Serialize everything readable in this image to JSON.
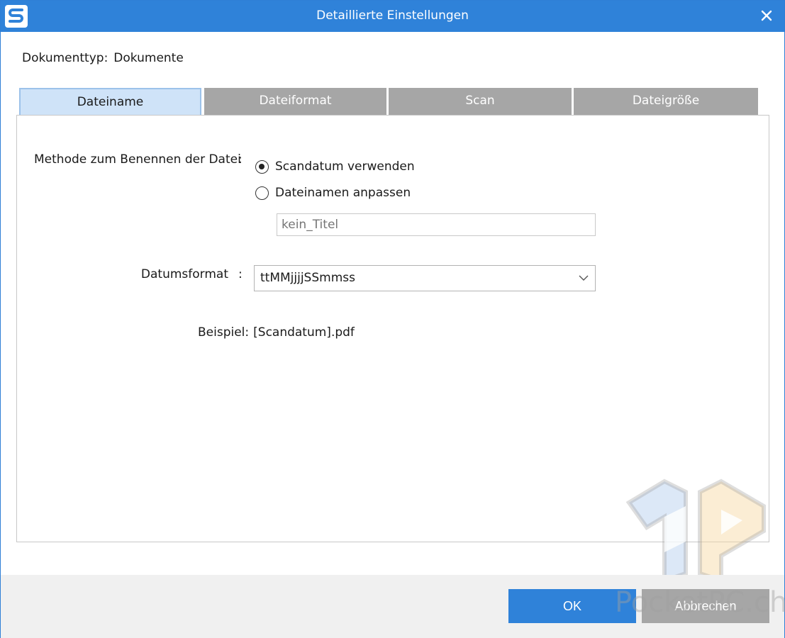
{
  "window": {
    "title": "Detaillierte Einstellungen",
    "accent": "#2f82d9"
  },
  "doctype": {
    "label": "Dokumenttyp:",
    "value": "Dokumente"
  },
  "tabs": [
    {
      "label": "Dateiname",
      "active": true
    },
    {
      "label": "Dateiformat",
      "active": false
    },
    {
      "label": "Scan",
      "active": false
    },
    {
      "label": "Dateigröße",
      "active": false
    }
  ],
  "naming": {
    "label": "Methode zum Benennen der Datei",
    "colon": ":",
    "options": [
      {
        "label": "Scandatum verwenden",
        "checked": true
      },
      {
        "label": "Dateinamen anpassen",
        "checked": false
      }
    ],
    "custom_name_placeholder": "kein_Titel"
  },
  "date_format": {
    "label": "Datumsformat",
    "colon": ":",
    "selected": "ttMMjjjjSSmmss"
  },
  "example": {
    "label": "Beispiel:",
    "value": "[Scandatum].pdf"
  },
  "buttons": {
    "ok": "OK",
    "cancel": "Abbrechen"
  },
  "watermark": {
    "text": "PocketPC.ch"
  },
  "icons": {
    "app": "scansnap-logo-icon",
    "close": "close-icon",
    "dropdown": "chevron-down-icon"
  }
}
